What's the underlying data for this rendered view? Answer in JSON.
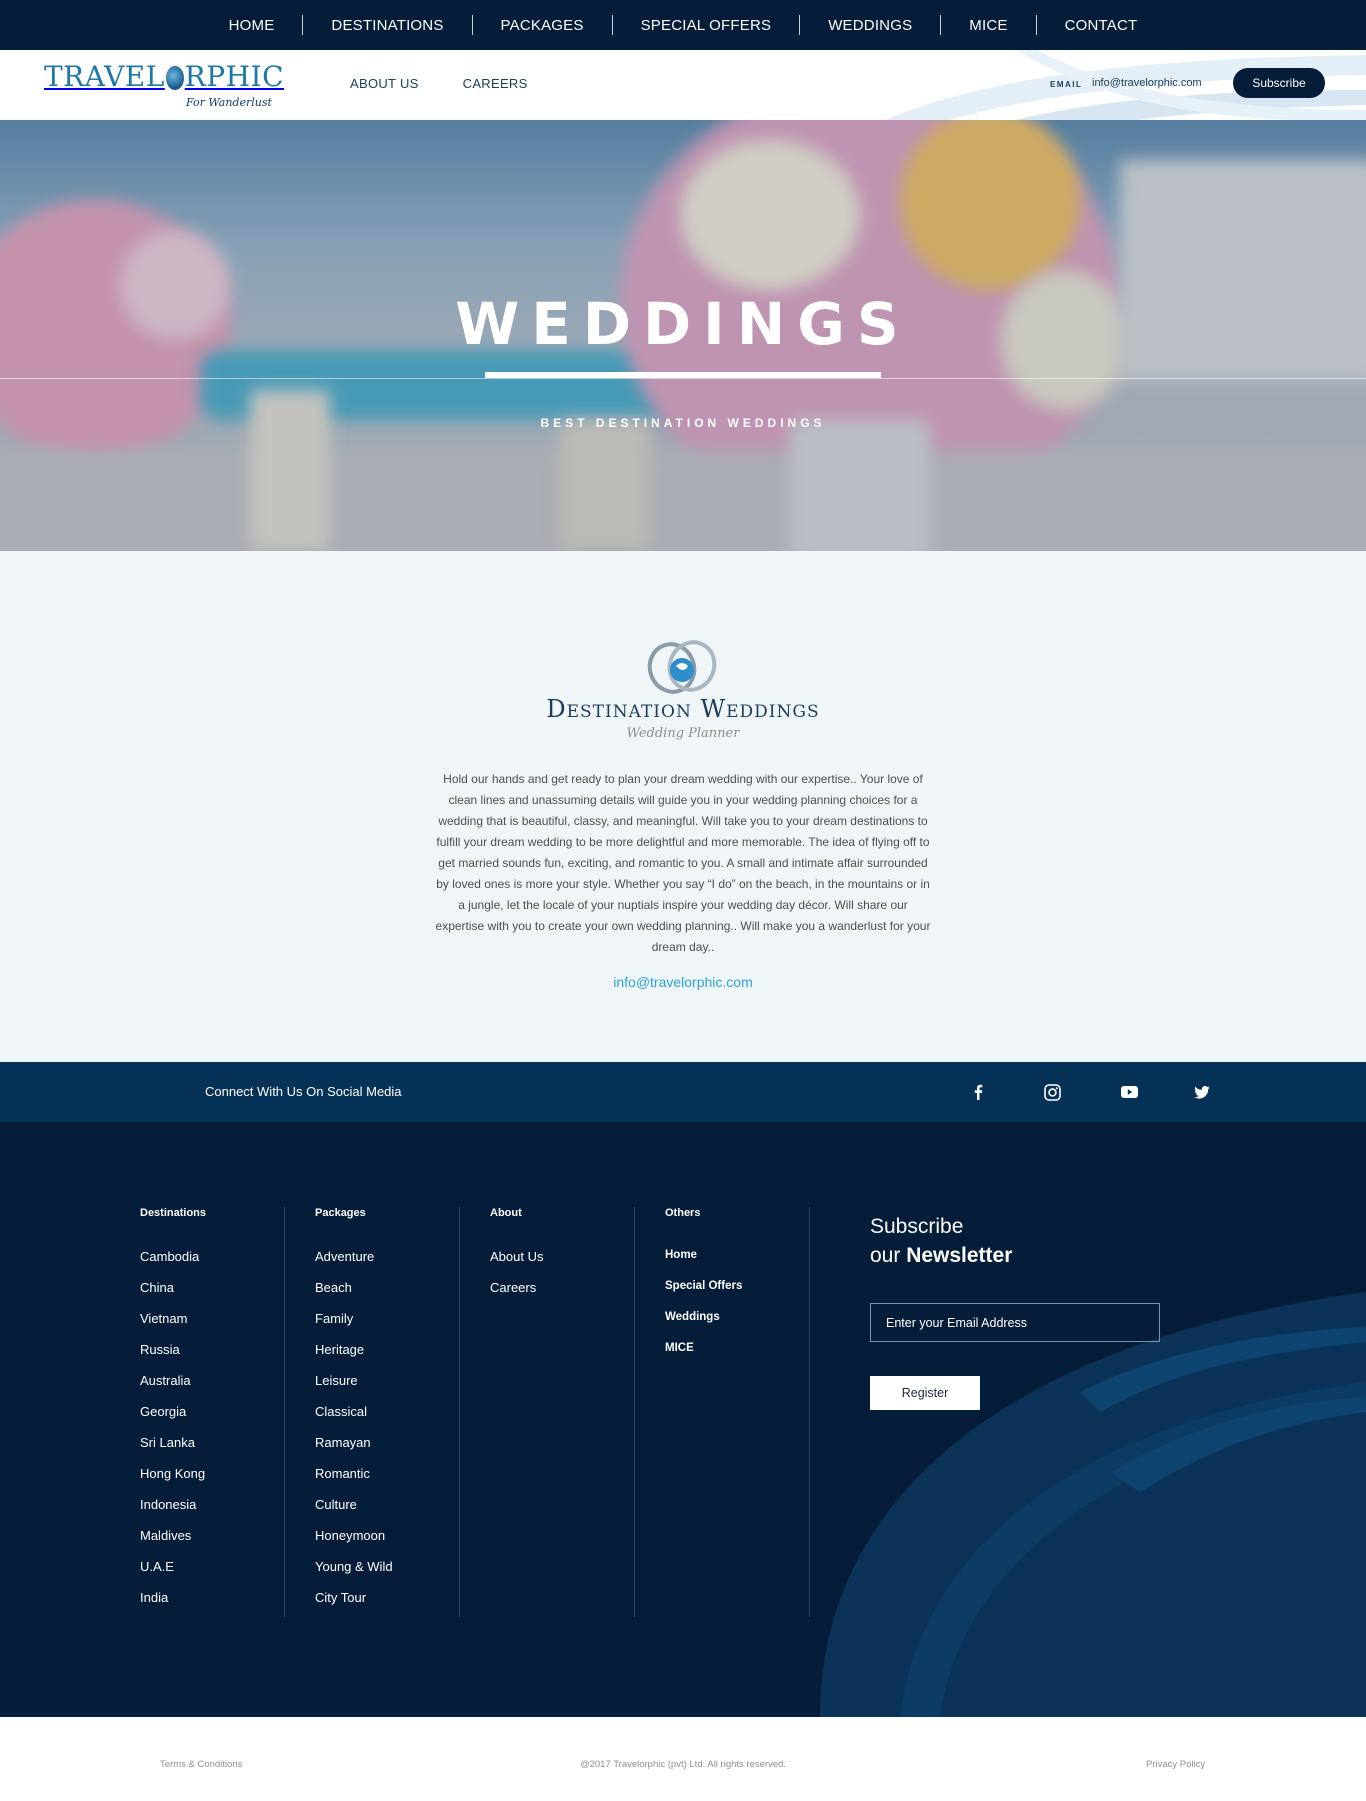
{
  "topnav": {
    "items": [
      "HOME",
      "DESTINATIONS",
      "PACKAGES",
      "SPECIAL OFFERS",
      "WEDDINGS",
      "MICE",
      "CONTACT"
    ]
  },
  "header": {
    "logo_prefix": "TRAVEL",
    "logo_suffix": "RPHIC",
    "logo_tagline": "For Wanderlust",
    "subnav": [
      "ABOUT US",
      "CAREERS"
    ],
    "email_label": "EMAIL",
    "email_value": "info@travelorphic.com",
    "subscribe_label": "Subscribe"
  },
  "hero": {
    "title": "WEDDINGS",
    "subtitle": "BEST DESTINATION WEDDINGS"
  },
  "content": {
    "heading": "Destination Weddings",
    "subheading": "Wedding Planner",
    "paragraph": "Hold our hands and get ready to plan your dream wedding with our expertise.. Your love of clean lines and unassuming details will guide you in your wedding planning choices for a wedding that is beautiful, classy, and meaningful. Will take you to your dream destinations to fulfill your dream wedding to be more delightful and more memorable. The idea of flying off to get married sounds fun, exciting, and romantic to you. A small and intimate affair surrounded by loved ones is more your style. Whether you say “I do” on the beach, in the mountains or in a jungle, let the locale of your nuptials inspire your wedding day décor. Will share our expertise with you to create your own wedding planning.. Will make you a wanderlust for your dream day..",
    "email": "info@travelorphic.com"
  },
  "social": {
    "label": "Connect With Us On Social Media",
    "icons": [
      "facebook-icon",
      "instagram-icon",
      "youtube-icon",
      "twitter-icon"
    ]
  },
  "footer": {
    "destinations": {
      "title": "Destinations",
      "items": [
        "Cambodia",
        "China",
        "Vietnam",
        "Russia",
        "Australia",
        "Georgia",
        "Sri Lanka",
        "Hong Kong",
        "Indonesia",
        "Maldives",
        "U.A.E",
        "India"
      ]
    },
    "packages": {
      "title": "Packages",
      "items": [
        "Adventure",
        "Beach",
        "Family",
        "Heritage",
        "Leisure",
        "Classical",
        "Ramayan",
        "Romantic",
        "Culture",
        "Honeymoon",
        "Young & Wild",
        "City Tour"
      ]
    },
    "about": {
      "title": "About",
      "items": [
        "About Us",
        "Careers"
      ]
    },
    "others": {
      "title": "Others",
      "items": [
        "Home",
        "Special Offers",
        "Weddings",
        "MICE"
      ]
    },
    "newsletter": {
      "line1": "Subscribe",
      "line2_prefix": "our ",
      "line2_bold": "Newsletter",
      "placeholder": "Enter your Email Address",
      "button": "Register"
    }
  },
  "bottom": {
    "terms": "Terms & Conditions",
    "copyright": "@2017 Travelorphic (pvt) Ltd. All rights reserved.",
    "privacy": "Privacy Policy"
  },
  "colors": {
    "navy": "#061d3a",
    "social_bar": "#073258",
    "content_bg": "#f0f5f8",
    "accent_link": "#2ba5d8",
    "brand_blue": "#1d77a9"
  }
}
